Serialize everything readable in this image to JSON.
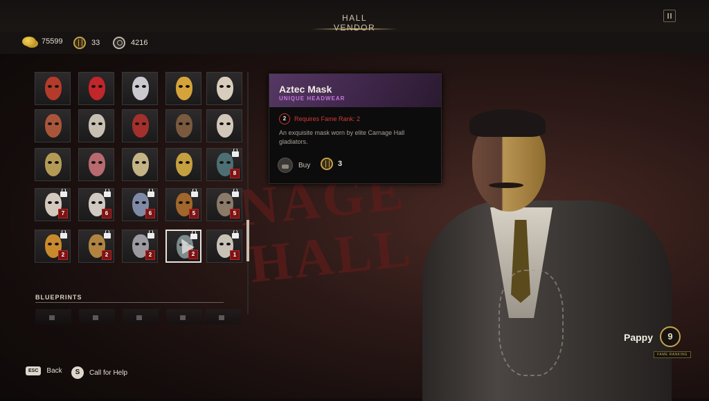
{
  "header": {
    "title": "HALL VENDOR"
  },
  "currencies": [
    {
      "icon": "gold-coins-icon",
      "value": "75599"
    },
    {
      "icon": "carnage-token-icon",
      "value": "33"
    },
    {
      "icon": "skull-currency-icon",
      "value": "4216"
    }
  ],
  "background_text": {
    "line1": "NAGE",
    "line2": "HALL"
  },
  "grid": {
    "rows": [
      [
        {
          "color": "#b43a2a",
          "rank": ""
        },
        {
          "color": "#c0262a",
          "rank": ""
        },
        {
          "color": "#c9c9cf",
          "rank": ""
        },
        {
          "color": "#d4a33a",
          "rank": ""
        },
        {
          "color": "#d8cdbd",
          "rank": ""
        }
      ],
      [
        {
          "color": "#a9553a",
          "rank": ""
        },
        {
          "color": "#c7c0b2",
          "rank": ""
        },
        {
          "color": "#a3302c",
          "rank": ""
        },
        {
          "color": "#7a5a3e",
          "rank": ""
        },
        {
          "color": "#d1c8b9",
          "rank": ""
        }
      ],
      [
        {
          "color": "#b49b55",
          "rank": ""
        },
        {
          "color": "#b86a6e",
          "rank": ""
        },
        {
          "color": "#c4b384",
          "rank": ""
        },
        {
          "color": "#c5a040",
          "rank": ""
        },
        {
          "color": "#4d6f73",
          "rank": "8"
        }
      ],
      [
        {
          "color": "#d3c8be",
          "rank": "7"
        },
        {
          "color": "#cfc9c2",
          "rank": "6"
        },
        {
          "color": "#7f8aa6",
          "rank": "6"
        },
        {
          "color": "#a0662c",
          "rank": "5"
        },
        {
          "color": "#8a7a68",
          "rank": "5"
        }
      ],
      [
        {
          "color": "#c98a2e",
          "rank": "2"
        },
        {
          "color": "#b08440",
          "rank": "2"
        },
        {
          "color": "#9a9aa0",
          "rank": "2"
        },
        {
          "color": "#7d8a8a",
          "rank": "2"
        },
        {
          "color": "#c8c2b6",
          "rank": "1"
        }
      ]
    ]
  },
  "blueprints": {
    "label": "BLUEPRINTS"
  },
  "tooltip": {
    "name": "Aztec Mask",
    "type": "UNIQUE HEADWEAR",
    "requirement_rank": "2",
    "requirement": "Requires Fame Rank: 2",
    "description": "An exquisite mask worn by elite Carnage Hall gladiators.",
    "buy_label": "Buy",
    "price": "3"
  },
  "character": {
    "name": "Pappy",
    "fame_rank": "9",
    "fame_label": "FAME RANKING"
  },
  "footer": {
    "back_key": "ESC",
    "back_label": "Back",
    "help_key": "S",
    "help_label": "Call for Help"
  }
}
